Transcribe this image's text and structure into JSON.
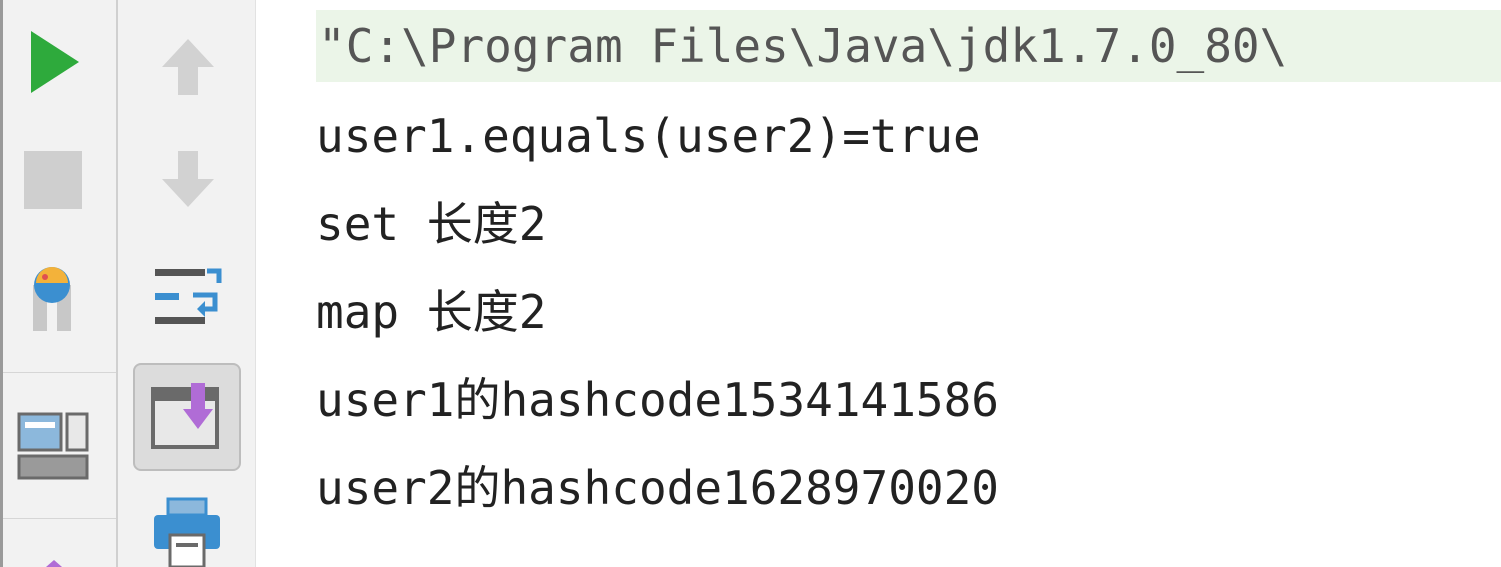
{
  "console": {
    "command": "\"C:\\Program Files\\Java\\jdk1.7.0_80\\",
    "lines": [
      "user1.equals(user2)=true",
      "set 长度2",
      "map 长度2",
      "user1的hashcode1534141586",
      "user2的hashcode1628970020"
    ]
  },
  "toolbar": {
    "left": [
      "run-icon",
      "stop-icon",
      "debug-pause-icon",
      "layout-icon",
      "pin-icon"
    ],
    "right": [
      "up-arrow-icon",
      "down-arrow-icon",
      "soft-wrap-icon",
      "scroll-to-end-icon",
      "print-icon"
    ]
  },
  "colors": {
    "run_green": "#2eaa3c",
    "command_bg": "#ebf5e8",
    "toolbar_bg": "#f2f2f2",
    "scroll_purple": "#b06cd6",
    "accent_blue": "#3b8fd0"
  }
}
